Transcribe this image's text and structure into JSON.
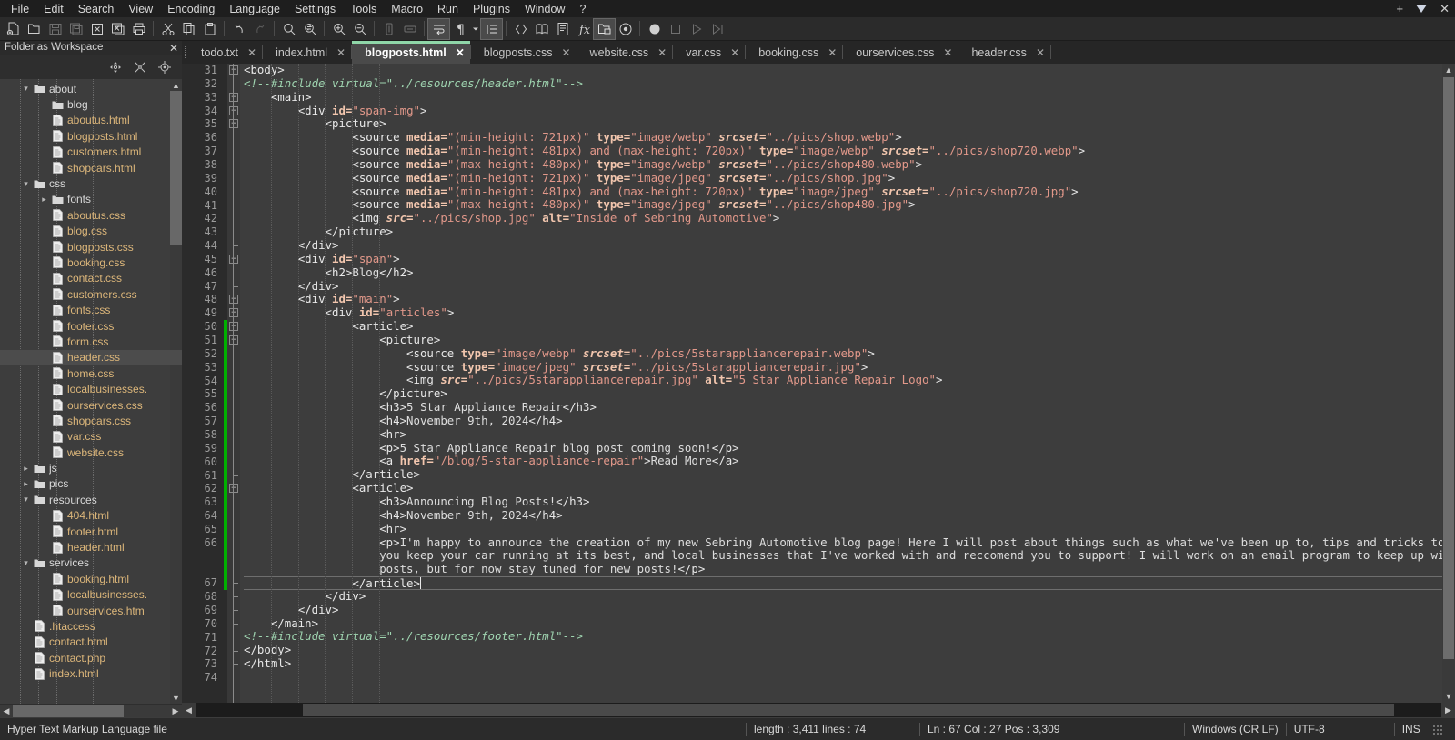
{
  "menu": {
    "items": [
      "File",
      "Edit",
      "Search",
      "View",
      "Encoding",
      "Language",
      "Settings",
      "Tools",
      "Macro",
      "Run",
      "Plugins",
      "Window",
      "?"
    ],
    "right": {
      "plus": "+",
      "close": "✕"
    }
  },
  "toolbar": {
    "icons": [
      "new-file-icon",
      "open-file-icon",
      "save-icon",
      "save-all-icon",
      "close-file-icon",
      "close-all-icon",
      "print-icon",
      "cut-icon",
      "copy-icon",
      "paste-icon",
      "undo-icon",
      "redo-icon",
      "find-icon",
      "replace-icon",
      "zoom-in-icon",
      "zoom-out-icon",
      "sync-vertical-icon",
      "sync-horizontal-icon",
      "word-wrap-icon",
      "show-all-chars-icon",
      "indent-guide-icon",
      "show-html-tag-icon",
      "user-defined-language-icon",
      "document-map-icon",
      "function-list-icon",
      "folder-workspace-icon",
      "monitoring-icon",
      "record-macro-icon",
      "stop-macro-icon",
      "play-macro-icon",
      "run-macro-multiple-icon"
    ]
  },
  "sidebar": {
    "title": "Folder as Workspace",
    "close_label": "✕",
    "tools": [
      "expand-all-icon",
      "collapse-all-icon",
      "locate-current-file-icon"
    ],
    "tree": [
      {
        "label": "about",
        "depth": 1,
        "type": "folder",
        "state": "open"
      },
      {
        "label": "blog",
        "depth": 2,
        "type": "folder",
        "state": "closed-noarrow"
      },
      {
        "label": "aboutus.html",
        "depth": 2,
        "type": "file"
      },
      {
        "label": "blogposts.html",
        "depth": 2,
        "type": "file"
      },
      {
        "label": "customers.html",
        "depth": 2,
        "type": "file"
      },
      {
        "label": "shopcars.html",
        "depth": 2,
        "type": "file"
      },
      {
        "label": "css",
        "depth": 1,
        "type": "folder",
        "state": "open"
      },
      {
        "label": "fonts",
        "depth": 2,
        "type": "folder",
        "state": "closed"
      },
      {
        "label": "aboutus.css",
        "depth": 2,
        "type": "file"
      },
      {
        "label": "blog.css",
        "depth": 2,
        "type": "file"
      },
      {
        "label": "blogposts.css",
        "depth": 2,
        "type": "file"
      },
      {
        "label": "booking.css",
        "depth": 2,
        "type": "file"
      },
      {
        "label": "contact.css",
        "depth": 2,
        "type": "file"
      },
      {
        "label": "customers.css",
        "depth": 2,
        "type": "file"
      },
      {
        "label": "fonts.css",
        "depth": 2,
        "type": "file"
      },
      {
        "label": "footer.css",
        "depth": 2,
        "type": "file"
      },
      {
        "label": "form.css",
        "depth": 2,
        "type": "file"
      },
      {
        "label": "header.css",
        "depth": 2,
        "type": "file",
        "selected": true
      },
      {
        "label": "home.css",
        "depth": 2,
        "type": "file"
      },
      {
        "label": "localbusinesses.",
        "depth": 2,
        "type": "file"
      },
      {
        "label": "ourservices.css",
        "depth": 2,
        "type": "file"
      },
      {
        "label": "shopcars.css",
        "depth": 2,
        "type": "file"
      },
      {
        "label": "var.css",
        "depth": 2,
        "type": "file"
      },
      {
        "label": "website.css",
        "depth": 2,
        "type": "file"
      },
      {
        "label": "js",
        "depth": 1,
        "type": "folder",
        "state": "closed"
      },
      {
        "label": "pics",
        "depth": 1,
        "type": "folder",
        "state": "closed"
      },
      {
        "label": "resources",
        "depth": 1,
        "type": "folder",
        "state": "open"
      },
      {
        "label": "404.html",
        "depth": 2,
        "type": "file"
      },
      {
        "label": "footer.html",
        "depth": 2,
        "type": "file"
      },
      {
        "label": "header.html",
        "depth": 2,
        "type": "file"
      },
      {
        "label": "services",
        "depth": 1,
        "type": "folder",
        "state": "open"
      },
      {
        "label": "booking.html",
        "depth": 2,
        "type": "file"
      },
      {
        "label": "localbusinesses.",
        "depth": 2,
        "type": "file"
      },
      {
        "label": "ourservices.htm",
        "depth": 2,
        "type": "file"
      },
      {
        "label": ".htaccess",
        "depth": 1,
        "type": "file"
      },
      {
        "label": "contact.html",
        "depth": 1,
        "type": "file"
      },
      {
        "label": "contact.php",
        "depth": 1,
        "type": "file"
      },
      {
        "label": "index.html",
        "depth": 1,
        "type": "file"
      }
    ]
  },
  "tabs": [
    {
      "label": "todo.txt",
      "active": false
    },
    {
      "label": "index.html",
      "active": false
    },
    {
      "label": "blogposts.html",
      "active": true
    },
    {
      "label": "blogposts.css",
      "active": false
    },
    {
      "label": "website.css",
      "active": false
    },
    {
      "label": "var.css",
      "active": false
    },
    {
      "label": "booking.css",
      "active": false
    },
    {
      "label": "ourservices.css",
      "active": false
    },
    {
      "label": "header.css",
      "active": false
    }
  ],
  "editor": {
    "first_line": 31,
    "last_line": 74,
    "current_line": 67,
    "line_numbers": [
      31,
      32,
      33,
      34,
      35,
      36,
      37,
      38,
      39,
      40,
      41,
      42,
      43,
      44,
      45,
      46,
      47,
      48,
      49,
      50,
      51,
      52,
      53,
      54,
      55,
      56,
      57,
      58,
      59,
      60,
      61,
      62,
      63,
      64,
      65,
      66,
      67,
      68,
      69,
      70,
      71,
      72,
      73,
      74
    ],
    "lines": [
      {
        "n": 31,
        "fold": "open",
        "html": "<span class='tag'>&lt;body&gt;</span>"
      },
      {
        "n": 32,
        "fold": null,
        "html": "<span class='cmt'>&lt;!--#include virtual=\"../resources/header.html\"--&gt;</span>"
      },
      {
        "n": 33,
        "fold": "open",
        "html": "    <span class='tag'>&lt;main&gt;</span>"
      },
      {
        "n": 34,
        "fold": "open",
        "html": "        <span class='tag'>&lt;div </span><span class='att'>id=</span><span class='str'>\"span-img\"</span><span class='tag'>&gt;</span>"
      },
      {
        "n": 35,
        "fold": "open",
        "html": "            <span class='tag'>&lt;picture&gt;</span>"
      },
      {
        "n": 36,
        "fold": null,
        "html": "                <span class='tag'>&lt;source </span><span class='att'>media=</span><span class='str'>\"(min-height: 721px)\"</span><span class='att'> type=</span><span class='str'>\"image/webp\"</span><span class='attI'> srcset=</span><span class='str'>\"../pics/shop.webp\"</span><span class='tag'>&gt;</span>"
      },
      {
        "n": 37,
        "fold": null,
        "html": "                <span class='tag'>&lt;source </span><span class='att'>media=</span><span class='str'>\"(min-height: 481px) and (max-height: 720px)\"</span><span class='att'> type=</span><span class='str'>\"image/webp\"</span><span class='attI'> srcset=</span><span class='str'>\"../pics/shop720.webp\"</span><span class='tag'>&gt;</span>"
      },
      {
        "n": 38,
        "fold": null,
        "html": "                <span class='tag'>&lt;source </span><span class='att'>media=</span><span class='str'>\"(max-height: 480px)\"</span><span class='att'> type=</span><span class='str'>\"image/webp\"</span><span class='attI'> srcset=</span><span class='str'>\"../pics/shop480.webp\"</span><span class='tag'>&gt;</span>"
      },
      {
        "n": 39,
        "fold": null,
        "html": "                <span class='tag'>&lt;source </span><span class='att'>media=</span><span class='str'>\"(min-height: 721px)\"</span><span class='att'> type=</span><span class='str'>\"image/jpeg\"</span><span class='attI'> srcset=</span><span class='str'>\"../pics/shop.jpg\"</span><span class='tag'>&gt;</span>"
      },
      {
        "n": 40,
        "fold": null,
        "html": "                <span class='tag'>&lt;source </span><span class='att'>media=</span><span class='str'>\"(min-height: 481px) and (max-height: 720px)\"</span><span class='att'> type=</span><span class='str'>\"image/jpeg\"</span><span class='attI'> srcset=</span><span class='str'>\"../pics/shop720.jpg\"</span><span class='tag'>&gt;</span>"
      },
      {
        "n": 41,
        "fold": null,
        "html": "                <span class='tag'>&lt;source </span><span class='att'>media=</span><span class='str'>\"(max-height: 480px)\"</span><span class='att'> type=</span><span class='str'>\"image/jpeg\"</span><span class='attI'> srcset=</span><span class='str'>\"../pics/shop480.jpg\"</span><span class='tag'>&gt;</span>"
      },
      {
        "n": 42,
        "fold": null,
        "html": "                <span class='tag'>&lt;img </span><span class='attI'>src=</span><span class='str'>\"../pics/shop.jpg\"</span><span class='att'> alt=</span><span class='str'>\"Inside of Sebring Automotive\"</span><span class='tag'>&gt;</span>"
      },
      {
        "n": 43,
        "fold": null,
        "html": "            <span class='tag'>&lt;/picture&gt;</span>"
      },
      {
        "n": 44,
        "fold": "end",
        "html": "        <span class='tag'>&lt;/div&gt;</span>"
      },
      {
        "n": 45,
        "fold": "open",
        "html": "        <span class='tag'>&lt;div </span><span class='att'>id=</span><span class='str'>\"span\"</span><span class='tag'>&gt;</span>"
      },
      {
        "n": 46,
        "fold": null,
        "html": "            <span class='tag'>&lt;h2&gt;</span><span class='txt'>Blog</span><span class='tag'>&lt;/h2&gt;</span>"
      },
      {
        "n": 47,
        "fold": "end",
        "html": "        <span class='tag'>&lt;/div&gt;</span>"
      },
      {
        "n": 48,
        "fold": "open",
        "html": "        <span class='tag'>&lt;div </span><span class='att'>id=</span><span class='str'>\"main\"</span><span class='tag'>&gt;</span>"
      },
      {
        "n": 49,
        "fold": "open",
        "html": "            <span class='tag'>&lt;div </span><span class='att'>id=</span><span class='str'>\"articles\"</span><span class='tag'>&gt;</span>"
      },
      {
        "n": 50,
        "fold": "open",
        "html": "                <span class='tag'>&lt;article&gt;</span>"
      },
      {
        "n": 51,
        "fold": "open",
        "html": "                    <span class='tag'>&lt;picture&gt;</span>"
      },
      {
        "n": 52,
        "fold": null,
        "html": "                        <span class='tag'>&lt;source </span><span class='att'>type=</span><span class='str'>\"image/webp\"</span><span class='attI'> srcset=</span><span class='str'>\"../pics/5starappliancerepair.webp\"</span><span class='tag'>&gt;</span>"
      },
      {
        "n": 53,
        "fold": null,
        "html": "                        <span class='tag'>&lt;source </span><span class='att'>type=</span><span class='str'>\"image/jpeg\"</span><span class='attI'> srcset=</span><span class='str'>\"../pics/5starappliancerepair.jpg\"</span><span class='tag'>&gt;</span>"
      },
      {
        "n": 54,
        "fold": null,
        "html": "                        <span class='tag'>&lt;img </span><span class='attI'>src=</span><span class='str'>\"../pics/5starappliancerepair.jpg\"</span><span class='att'> alt=</span><span class='str'>\"5 Star Appliance Repair Logo\"</span><span class='tag'>&gt;</span>"
      },
      {
        "n": 55,
        "fold": null,
        "html": "                    <span class='tag'>&lt;/picture&gt;</span>"
      },
      {
        "n": 56,
        "fold": null,
        "html": "                    <span class='tag'>&lt;h3&gt;</span><span class='txt'>5 Star Appliance Repair</span><span class='tag'>&lt;/h3&gt;</span>"
      },
      {
        "n": 57,
        "fold": null,
        "html": "                    <span class='tag'>&lt;h4&gt;</span><span class='txt'>November 9th, 2024</span><span class='tag'>&lt;/h4&gt;</span>"
      },
      {
        "n": 58,
        "fold": null,
        "html": "                    <span class='tag'>&lt;hr&gt;</span>"
      },
      {
        "n": 59,
        "fold": null,
        "html": "                    <span class='tag'>&lt;p&gt;</span><span class='txt'>5 Star Appliance Repair blog post coming soon!</span><span class='tag'>&lt;/p&gt;</span>"
      },
      {
        "n": 60,
        "fold": null,
        "html": "                    <span class='tag'>&lt;a </span><span class='att'>href=</span><span class='str'>\"/blog/5-star-appliance-repair\"</span><span class='tag'>&gt;</span><span class='txt'>Read More</span><span class='tag'>&lt;/a&gt;</span>"
      },
      {
        "n": 61,
        "fold": "end",
        "html": "                <span class='tag'>&lt;/article&gt;</span>"
      },
      {
        "n": 62,
        "fold": "open",
        "html": "                <span class='tag'>&lt;article&gt;</span>"
      },
      {
        "n": 63,
        "fold": null,
        "html": "                    <span class='tag'>&lt;h3&gt;</span><span class='txt'>Announcing Blog Posts!</span><span class='tag'>&lt;/h3&gt;</span>"
      },
      {
        "n": 64,
        "fold": null,
        "html": "                    <span class='tag'>&lt;h4&gt;</span><span class='txt'>November 9th, 2024</span><span class='tag'>&lt;/h4&gt;</span>"
      },
      {
        "n": 65,
        "fold": null,
        "html": "                    <span class='tag'>&lt;hr&gt;</span>"
      },
      {
        "n": 66,
        "fold": null,
        "wrapped": true,
        "html": "                    <span class='tag'>&lt;p&gt;</span><span class='txt'>I'm happy to announce the creation of my new Sebring Automotive blog page! Here I will post about things such as what we've been up to, tips and tricks to help</span>",
        "wrap2": "                    <span class='txt'>you keep your car running at its best, and local businesses that I've worked with and reccomend you to support! I will work on an email program to keep up with our</span>",
        "wrap3": "                    <span class='txt'>posts, but for now stay tuned for new posts!</span><span class='tag'>&lt;/p&gt;</span>"
      },
      {
        "n": 67,
        "fold": "end",
        "current": true,
        "html": "                <span class='tag'>&lt;/article&gt;</span><span class='caret'></span>"
      },
      {
        "n": 68,
        "fold": "end",
        "html": "            <span class='tag'>&lt;/div&gt;</span>"
      },
      {
        "n": 69,
        "fold": "end",
        "html": "        <span class='tag'>&lt;/div&gt;</span>"
      },
      {
        "n": 70,
        "fold": "end",
        "html": "    <span class='tag'>&lt;/main&gt;</span>"
      },
      {
        "n": 71,
        "fold": null,
        "html": "<span class='cmt'>&lt;!--#include virtual=\"../resources/footer.html\"--&gt;</span>"
      },
      {
        "n": 72,
        "fold": "end",
        "html": "<span class='tag'>&lt;/body&gt;</span>"
      },
      {
        "n": 73,
        "fold": "end",
        "html": "<span class='tag'>&lt;/html&gt;</span>"
      },
      {
        "n": 74,
        "fold": null,
        "html": ""
      }
    ]
  },
  "status": {
    "file_type": "Hyper Text Markup Language file",
    "length_lines": "length : 3,411   lines : 74",
    "caret": "Ln : 67   Col : 27   Pos : 3,309",
    "eol": "Windows (CR LF)",
    "encoding": "UTF-8",
    "insert_mode": "INS"
  }
}
